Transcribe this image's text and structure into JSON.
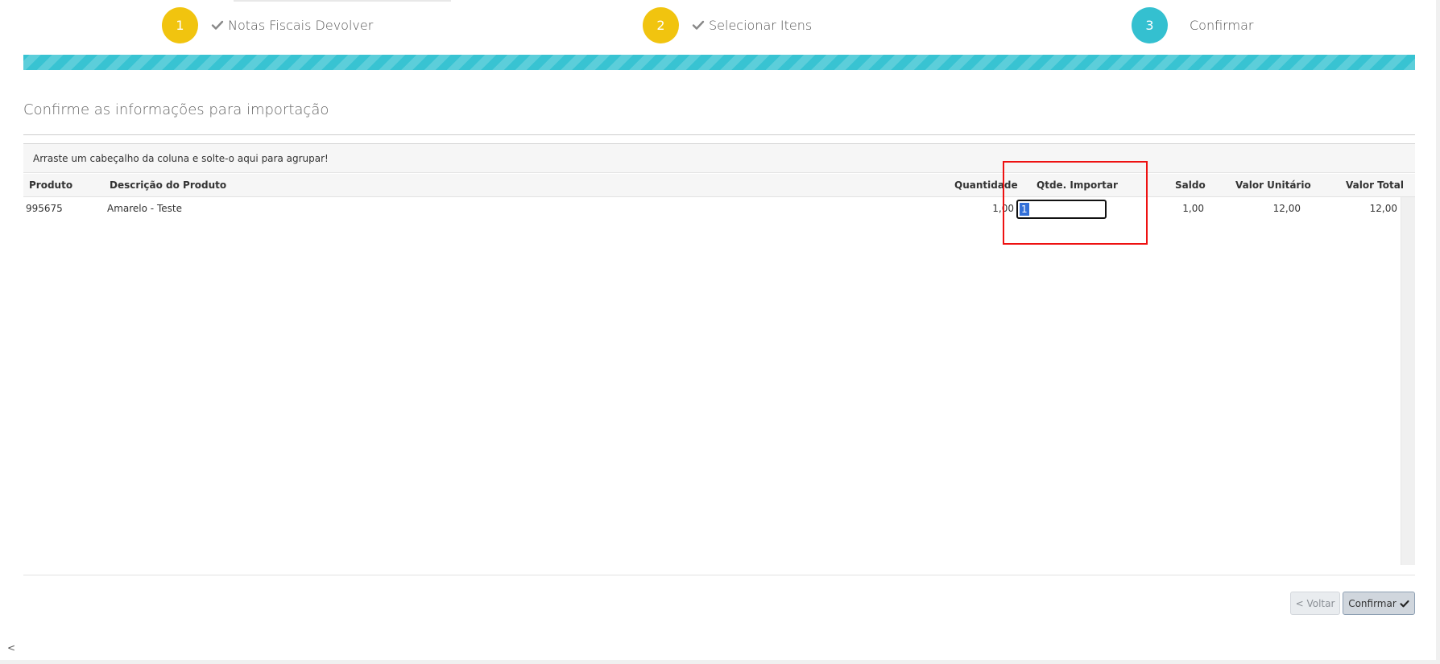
{
  "wizard": {
    "steps": [
      {
        "number": "1",
        "label": "Notas Fiscais Devolver",
        "completed": true,
        "color": "#f1c40f"
      },
      {
        "number": "2",
        "label": "Selecionar Itens",
        "completed": true,
        "color": "#f1c40f"
      },
      {
        "number": "3",
        "label": "Confirmar",
        "completed": false,
        "color": "#34c0d0"
      }
    ],
    "progress_percent": 100,
    "progress_color": "#38c3d2"
  },
  "main": {
    "title": "Confirme as informações para importação"
  },
  "grid": {
    "group_panel_text": "Arraste um cabeçalho da coluna e solte-o aqui para agrupar!",
    "columns": [
      "Produto",
      "Descrição do Produto",
      "Quantidade",
      "Qtde. Importar",
      "Saldo",
      "Valor Unitário",
      "Valor Total"
    ],
    "rows": [
      {
        "produto": "995675",
        "descricao": "Amarelo - Teste",
        "quantidade": "1,00",
        "qtde_importar": "1",
        "saldo": "1,00",
        "valor_unitario": "12,00",
        "valor_total": "12,00"
      }
    ]
  },
  "footer": {
    "voltar_label": "< Voltar",
    "confirmar_label": "Confirmar",
    "corner_arrow": "<"
  },
  "colors": {
    "step_yellow": "#f1c40f",
    "step_teal": "#34c0d0",
    "highlight_red": "#ee1111"
  },
  "icons": {
    "step_completed": "check-icon",
    "confirm_button": "check-icon"
  }
}
